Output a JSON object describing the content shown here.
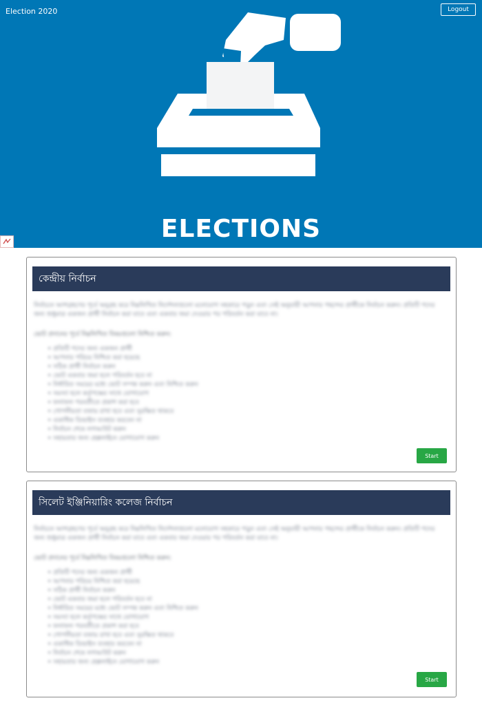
{
  "header": {
    "app_title": "Election 2020",
    "logout_label": "Logout",
    "hero_title": "ELECTIONS"
  },
  "elections": [
    {
      "title": "কেন্দ্রীয় নির্বাচন",
      "paragraph": "নির্বাচনে অংশগ্রহণের পূর্বে অনুগ্রহ করে নিম্নলিখিত নির্দেশনাগুলো মনোযোগ সহকারে পড়ুন এবং সেই অনুযায়ী আপনার পছন্দের প্রার্থীকে নির্বাচন করুন। প্রতিটি পদের জন্য শুধুমাত্র একজন প্রার্থী নির্বাচন করা যাবে এবং একবার জমা দেওয়ার পর পরিবর্তন করা যাবে না।",
      "lead": "ভোট প্রদানের পূর্বে নিম্নলিখিত বিষয়গুলো নিশ্চিত করুন:",
      "items": [
        "প্রতিটি পদের জন্য একজন প্রার্থী",
        "আপনার পরিচয় নিশ্চিত করা হয়েছে",
        "সঠিক প্রার্থী নির্বাচন করুন",
        "ভোট একবার জমা হলে পরিবর্তন হবে না",
        "নির্ধারিত সময়ের মধ্যে ভোট সম্পন্ন করুন এবং নিশ্চিত করুন",
        "সমস্যা হলে কর্তৃপক্ষের সাথে যোগাযোগ",
        "ফলাফল পরবর্তীতে প্রকাশ করা হবে",
        "গোপনীয়তা বজায় রাখা হবে এবং সুরক্ষিত থাকবে",
        "একাধিক ডিভাইস ব্যবহার করবেন না",
        "নির্বাচন শেষে লগআউট করুন",
        "সহায়তার জন্য হেল্পলাইনে যোগাযোগ করুন"
      ],
      "start_label": "Start"
    },
    {
      "title": "সিলেট ইঞ্জিনিয়ারিং কলেজ নির্বাচন",
      "paragraph": "নির্বাচনে অংশগ্রহণের পূর্বে অনুগ্রহ করে নিম্নলিখিত নির্দেশনাগুলো মনোযোগ সহকারে পড়ুন এবং সেই অনুযায়ী আপনার পছন্দের প্রার্থীকে নির্বাচন করুন। প্রতিটি পদের জন্য শুধুমাত্র একজন প্রার্থী নির্বাচন করা যাবে এবং একবার জমা দেওয়ার পর পরিবর্তন করা যাবে না।",
      "lead": "ভোট প্রদানের পূর্বে নিম্নলিখিত বিষয়গুলো নিশ্চিত করুন:",
      "items": [
        "প্রতিটি পদের জন্য একজন প্রার্থী",
        "আপনার পরিচয় নিশ্চিত করা হয়েছে",
        "সঠিক প্রার্থী নির্বাচন করুন",
        "ভোট একবার জমা হলে পরিবর্তন হবে না",
        "নির্ধারিত সময়ের মধ্যে ভোট সম্পন্ন করুন এবং নিশ্চিত করুন",
        "সমস্যা হলে কর্তৃপক্ষের সাথে যোগাযোগ",
        "ফলাফল পরবর্তীতে প্রকাশ করা হবে",
        "গোপনীয়তা বজায় রাখা হবে এবং সুরক্ষিত থাকবে",
        "একাধিক ডিভাইস ব্যবহার করবেন না",
        "নির্বাচন শেষে লগআউট করুন",
        "সহায়তার জন্য হেল্পলাইনে যোগাযোগ করুন"
      ],
      "start_label": "Start"
    }
  ],
  "colors": {
    "hero_bg": "#0077b6",
    "card_header_bg": "#2a3b5a",
    "start_button": "#28a745"
  }
}
